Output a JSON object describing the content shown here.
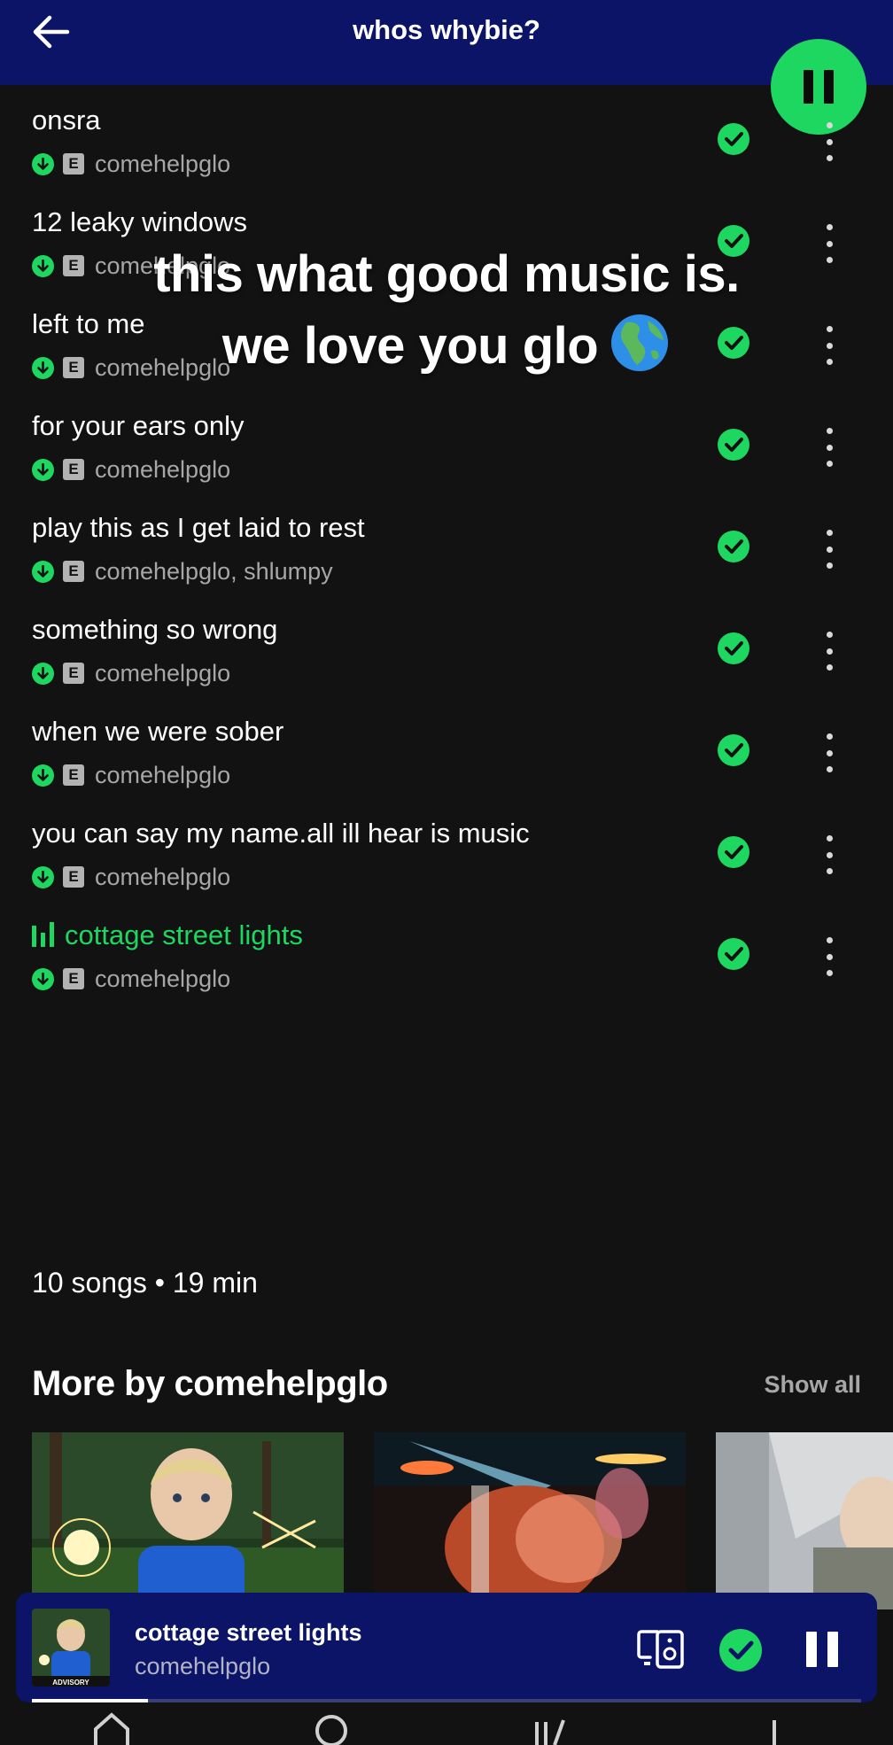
{
  "header": {
    "title": "whos whybie?"
  },
  "tracks": [
    {
      "title": "onsra",
      "artist": "comehelpglo",
      "explicit": "E",
      "playing": false
    },
    {
      "title": "12 leaky windows",
      "artist": "comehelpglo",
      "explicit": "E",
      "playing": false
    },
    {
      "title": "left to me",
      "artist": "comehelpglo",
      "explicit": "E",
      "playing": false
    },
    {
      "title": "for your ears only",
      "artist": "comehelpglo",
      "explicit": "E",
      "playing": false
    },
    {
      "title": "play this as I get laid to rest",
      "artist": "comehelpglo, shlumpy",
      "explicit": "E",
      "playing": false
    },
    {
      "title": "something so wrong",
      "artist": "comehelpglo",
      "explicit": "E",
      "playing": false
    },
    {
      "title": "when we were sober",
      "artist": "comehelpglo",
      "explicit": "E",
      "playing": false
    },
    {
      "title": "you can say my name.all ill hear is music",
      "artist": "comehelpglo",
      "explicit": "E",
      "playing": false
    },
    {
      "title": "cottage street lights",
      "artist": "comehelpglo",
      "explicit": "E",
      "playing": true
    }
  ],
  "overlay": {
    "line1": "this what good music is.",
    "line2": "we love you glo"
  },
  "summary": "10 songs • 19 min",
  "more_section": {
    "heading": "More by comehelpglo",
    "show_all": "Show all"
  },
  "mini_player": {
    "title": "cottage street lights",
    "artist": "comehelpglo",
    "progress": 0.14,
    "art_label": "ADVISORY"
  },
  "colors": {
    "accent": "#1ed760",
    "header_bg": "#0b1466",
    "bg": "#121212",
    "muted": "#a7a7a7"
  }
}
